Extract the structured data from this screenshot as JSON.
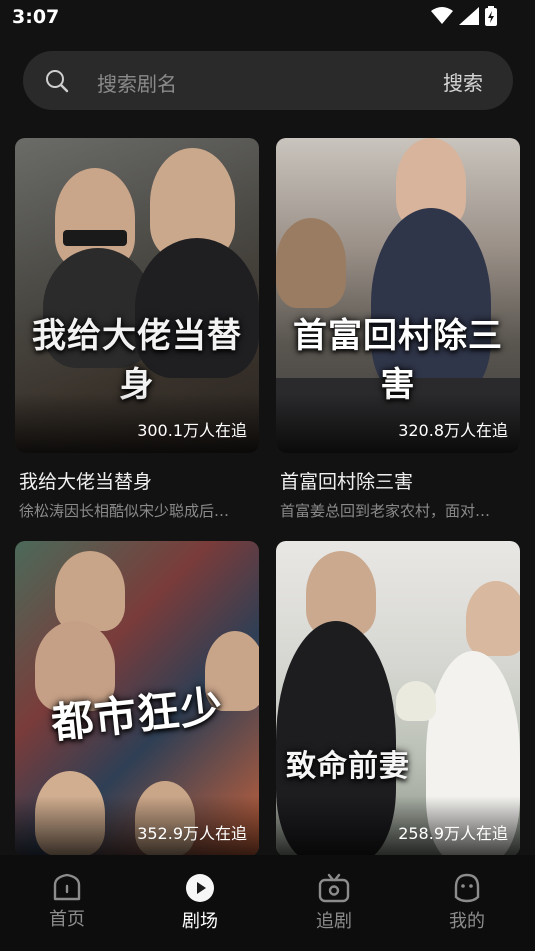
{
  "status": {
    "time": "3:07"
  },
  "search": {
    "placeholder": "搜索剧名",
    "button_label": "搜索"
  },
  "cards": [
    {
      "overlay_title": "我给大佬当替身",
      "followers": "300.1万人在追",
      "title": "我给大佬当替身",
      "description": "徐松涛因长相酷似宋少聪成后…"
    },
    {
      "overlay_title": "首富回村除三害",
      "followers": "320.8万人在追",
      "title": "首富回村除三害",
      "description": "首富姜总回到老家农村，面对…"
    },
    {
      "overlay_title": "都市狂少",
      "followers": "352.9万人在追"
    },
    {
      "overlay_title": "致命前妻",
      "followers": "258.9万人在追"
    }
  ],
  "tabs": [
    {
      "label": "首页",
      "icon": "home-icon"
    },
    {
      "label": "剧场",
      "icon": "play-icon",
      "active": true
    },
    {
      "label": "追剧",
      "icon": "tv-icon"
    },
    {
      "label": "我的",
      "icon": "profile-icon"
    }
  ]
}
